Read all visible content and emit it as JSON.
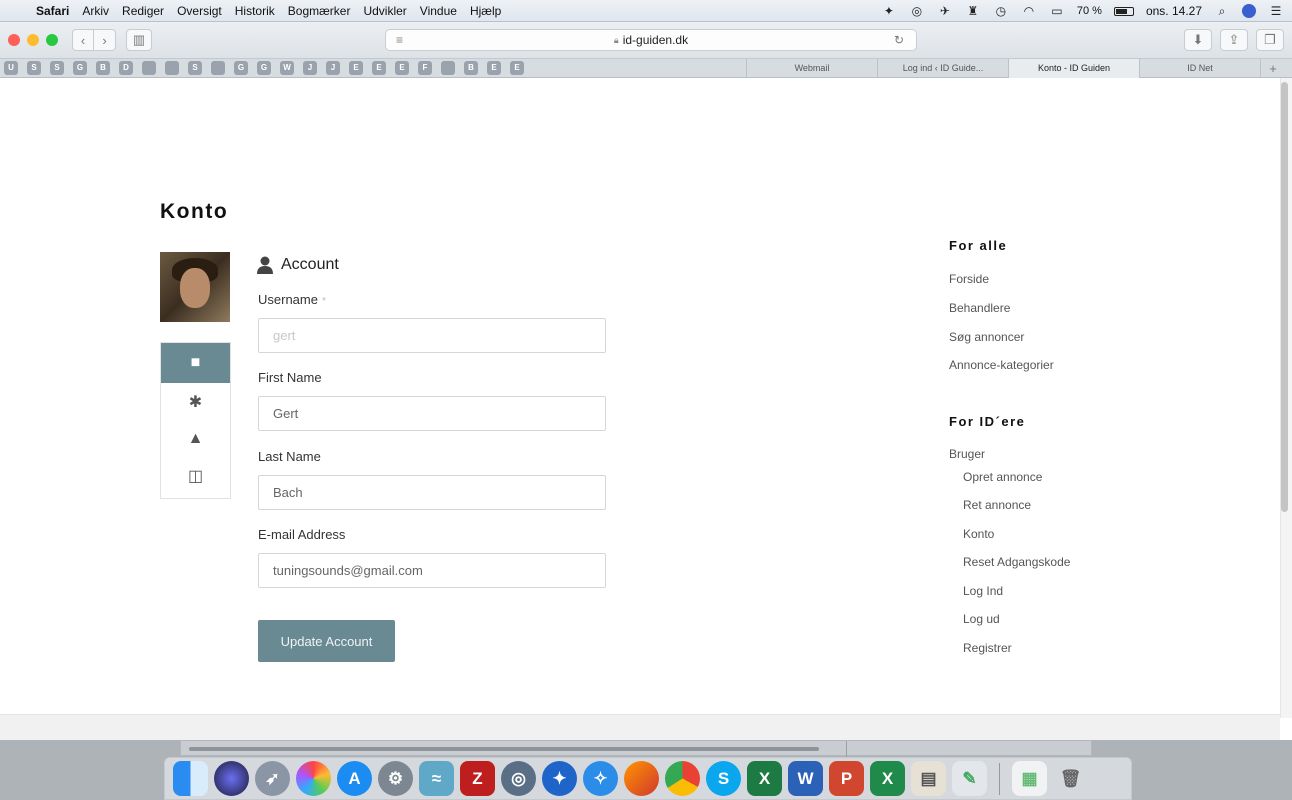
{
  "menubar": {
    "app": "Safari",
    "items": [
      "Arkiv",
      "Rediger",
      "Oversigt",
      "Historik",
      "Bogmærker",
      "Udvikler",
      "Vindue",
      "Hjælp"
    ],
    "battery": "70 %",
    "clock": "ons. 14.27",
    "battery_level": 0.7
  },
  "browser": {
    "url": "id-guiden.dk",
    "bookmarks": [
      "U",
      "S",
      "S",
      "G",
      "B",
      "D",
      "",
      "",
      "S",
      "",
      "G",
      "G",
      "W",
      "J",
      "J",
      "E",
      "E",
      "E",
      "F",
      "",
      "B",
      "E",
      "E"
    ],
    "tabs": [
      {
        "label": "Webmail",
        "active": false
      },
      {
        "label": "Log ind ‹ ID Guide...",
        "active": false
      },
      {
        "label": "Konto - ID Guiden",
        "active": true
      },
      {
        "label": "ID Net",
        "active": false
      }
    ],
    "new_tab": "+"
  },
  "page": {
    "title": "Konto",
    "section_title": "Account",
    "fields": {
      "username": {
        "label": "Username",
        "required": "*",
        "value": "gert"
      },
      "first_name": {
        "label": "First Name",
        "value": "Gert"
      },
      "last_name": {
        "label": "Last Name",
        "value": "Bach"
      },
      "email": {
        "label": "E-mail Address",
        "value": "tuningsounds@gmail.com"
      }
    },
    "update_button": "Update Account"
  },
  "sidebar": {
    "for_alle_title": "For alle",
    "for_alle_links": [
      "Forside",
      "Behandlere",
      "Søg annoncer",
      "Annonce-kategorier"
    ],
    "for_idere_title": "For ID´ere",
    "bruger_label": "Bruger",
    "bruger_links": [
      "Opret annonce",
      "Ret annonce",
      "Konto",
      "Reset Adgangskode",
      "Log Ind",
      "Log ud",
      "Registrer"
    ]
  },
  "colors": {
    "accent": "#6a8a93",
    "traffic_red": "#fc5f57",
    "traffic_yellow": "#fdbc2e",
    "traffic_green": "#28c840"
  }
}
